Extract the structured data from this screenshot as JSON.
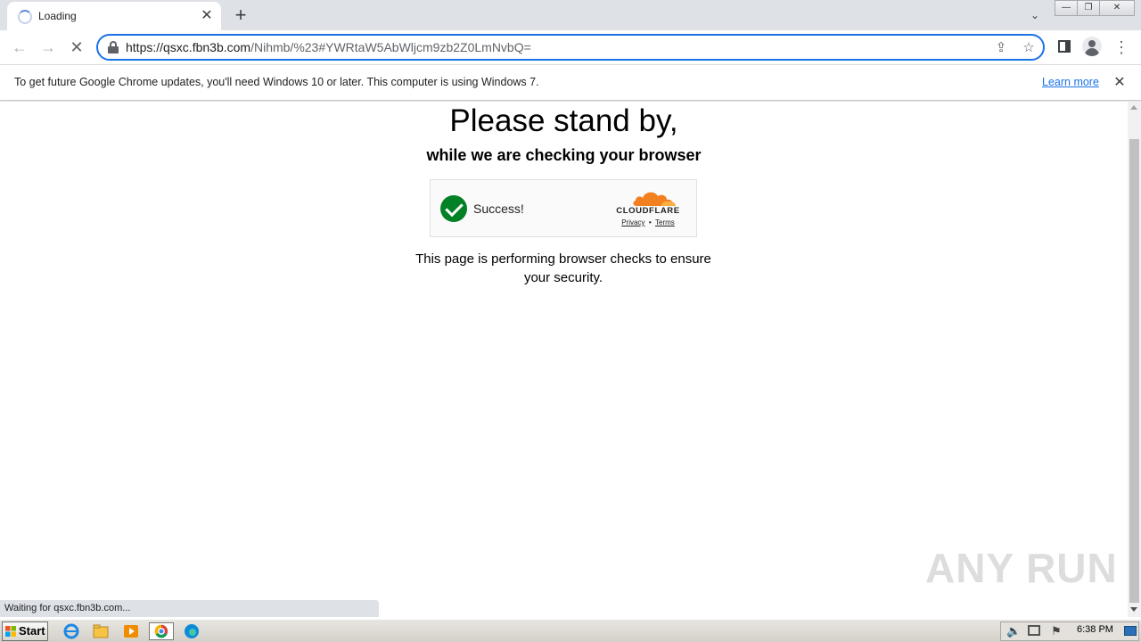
{
  "tab": {
    "title": "Loading",
    "close_label": "✕"
  },
  "new_tab_label": "+",
  "tab_search_label": "⌄",
  "window_controls": {
    "minimize": "—",
    "restore": "❐",
    "close": "✕"
  },
  "toolbar": {
    "back": "←",
    "forward": "→",
    "stop": "✕",
    "url_domain": "https://qsxc.fbn3b.com",
    "url_path": "/Nihmb/%23#YWRtaW5AbWljcm9zb2Z0LmNvbQ=",
    "share": "⇪",
    "bookmark": "☆",
    "menu": "⋮"
  },
  "infobar": {
    "message": "To get future Google Chrome updates, you'll need Windows 10 or later. This computer is using Windows 7.",
    "learn_more": "Learn more",
    "close": "✕"
  },
  "page": {
    "headline": "Please stand by,",
    "subheadline": "while we are checking your browser",
    "widget": {
      "status": "Success!",
      "brand": "CLOUDFLARE",
      "privacy": "Privacy",
      "separator": "•",
      "terms": "Terms"
    },
    "security_text": "This page is performing browser checks to ensure your security."
  },
  "watermark": "ANY RUN",
  "status_bar": "Waiting for qsxc.fbn3b.com...",
  "taskbar": {
    "start": "Start",
    "clock": "6:38 PM"
  },
  "colors": {
    "accent": "#1a73e8",
    "success": "#038127",
    "cloudflare_orange": "#f38020"
  }
}
